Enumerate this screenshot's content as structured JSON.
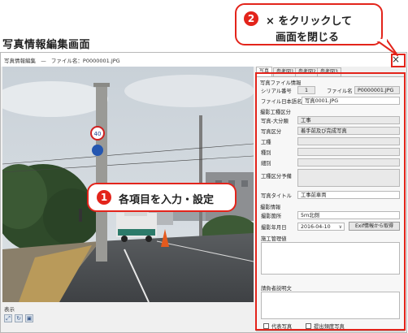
{
  "screen_title": "写真情報編集画面",
  "window": {
    "title": "写真情報編集",
    "separator": "—",
    "filename_label": "ファイル名：P0000001.JPG",
    "close": "×"
  },
  "left_bottom": {
    "display_label": "表示",
    "tools": [
      "zoom-fit-icon",
      "rotate-icon",
      "picture-icon"
    ]
  },
  "tabs": [
    "写真",
    "参考図1",
    "参考図2",
    "参考図3"
  ],
  "form": {
    "photo_file_info_heading": "写真ファイル情報",
    "serial_label": "シリアル番号",
    "serial_value": "1",
    "filename_label": "ファイル名",
    "filename_value": "P0000001.JPG",
    "file_title_label": "ファイル日本語名",
    "file_title_value": "写真0001.JPG",
    "category_heading": "撮影工種区分",
    "major_class_label": "写真-大分類",
    "major_class_value": "工事",
    "photo_class_label": "写真区分",
    "photo_class_value": "着手前及び完成写真",
    "work_type_label": "工種",
    "kind_label": "種別",
    "detail_label": "細別",
    "sub_label": "工種区分予備",
    "photo_title_label": "写真タイトル",
    "photo_title_value": "工事前車両",
    "shoot_info_heading": "撮影情報",
    "location_label": "撮影箇所",
    "location_value": "5ｍ北側",
    "date_label": "撮影年月日",
    "date_value": "2016-04-10",
    "exif_button": "Exif情報から取得",
    "management_label": "施工管理値",
    "contractor_label": "請負者説明文",
    "representative_label": "代表写真",
    "submission_label": "提出頻度写真"
  },
  "callouts": {
    "one_number": "1",
    "one_text": "各項目を入力・設定",
    "two_number": "2",
    "two_text_line1": "× をクリックして",
    "two_text_line2": "画面を閉じる"
  },
  "colors": {
    "accent_red": "#e3241b",
    "window_bg": "#f0f0f0"
  }
}
